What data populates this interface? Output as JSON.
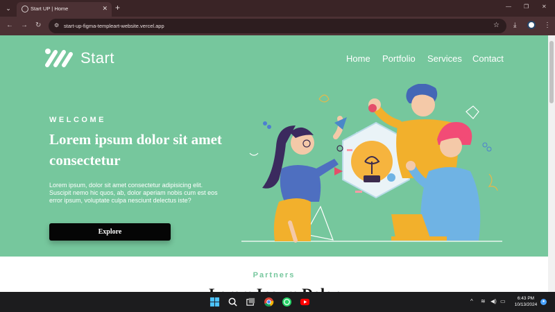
{
  "browser": {
    "tab_title": "Start UP | Home",
    "url": "start-up-figma-templeart-website.vercel.app",
    "icons": [
      "tab-search-icon",
      "close-icon",
      "new-tab-icon",
      "minimize-icon",
      "maximize-icon",
      "window-close-icon",
      "back-icon",
      "forward-icon",
      "reload-icon",
      "site-info-icon",
      "bookmark-star-icon",
      "download-icon",
      "profile-icon",
      "menu-icon"
    ]
  },
  "site": {
    "logo_text": "Start",
    "nav": [
      "Home",
      "Portfolio",
      "Services",
      "Contact"
    ],
    "hero": {
      "eyebrow": "WELCOME",
      "headline": "Lorem ipsum dolor sit amet consectetur",
      "body": "Lorem ipsum, dolor sit amet consectetur adipisicing elit. Suscipit nemo hic quos, ab, dolor aperiam nobis cum est eos error ipsum, voluptate culpa nesciunt delectus iste?",
      "cta_label": "Explore"
    },
    "partners": {
      "eyebrow": "Partners",
      "title": "Lorem Ipsum Dolor"
    },
    "colors": {
      "hero_bg": "#76c79d",
      "accent": "#76c79d",
      "button_bg": "#050505",
      "text_light": "#ffffff"
    }
  },
  "taskbar": {
    "apps": [
      "windows-start-icon",
      "search-icon",
      "task-view-icon",
      "chrome-icon",
      "whatsapp-icon",
      "youtube-icon"
    ],
    "time": "6:43 PM",
    "date": "10/13/2024"
  }
}
